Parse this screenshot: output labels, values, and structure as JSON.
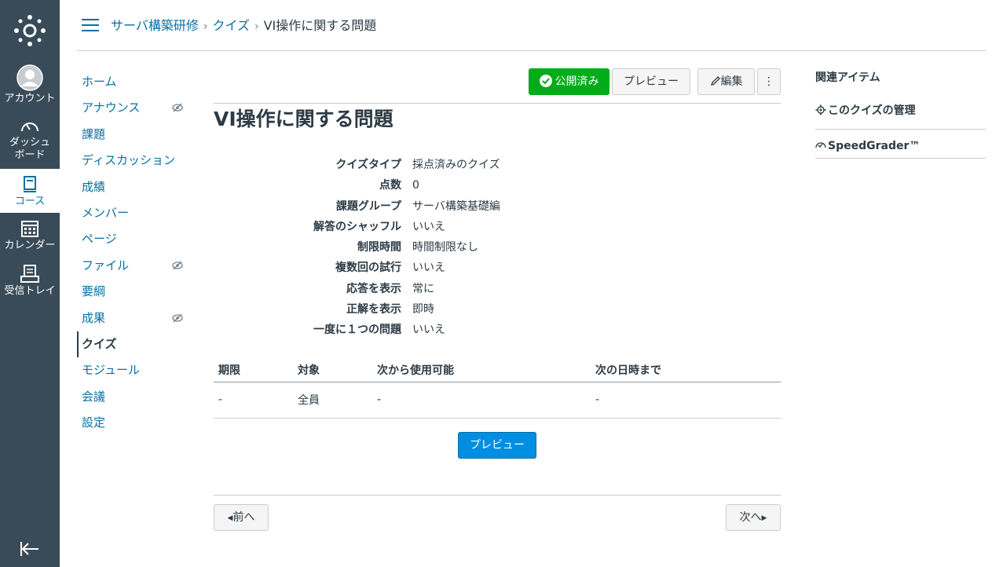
{
  "global_nav": {
    "items": [
      {
        "label": "アカウント",
        "icon": "avatar-icon"
      },
      {
        "label": "ダッシュ\nボード",
        "label1": "ダッシュ",
        "label2": "ボード",
        "icon": "dashboard-icon"
      },
      {
        "label": "コース",
        "icon": "courses-icon"
      },
      {
        "label": "カレンダー",
        "icon": "calendar-icon"
      },
      {
        "label": "受信トレイ",
        "icon": "inbox-icon"
      }
    ],
    "active_index": 2
  },
  "breadcrumb": {
    "items": [
      "サーバ構築研修",
      "クイズ",
      "VI操作に関する問題"
    ]
  },
  "course_nav": {
    "items": [
      {
        "label": "ホーム",
        "hidden": false
      },
      {
        "label": "アナウンス",
        "hidden": true
      },
      {
        "label": "課題",
        "hidden": false
      },
      {
        "label": "ディスカッション",
        "hidden": false
      },
      {
        "label": "成績",
        "hidden": false
      },
      {
        "label": "メンバー",
        "hidden": false
      },
      {
        "label": "ページ",
        "hidden": false
      },
      {
        "label": "ファイル",
        "hidden": true
      },
      {
        "label": "要綱",
        "hidden": false
      },
      {
        "label": "成果",
        "hidden": true
      },
      {
        "label": "クイズ",
        "hidden": false
      },
      {
        "label": "モジュール",
        "hidden": false
      },
      {
        "label": "会議",
        "hidden": false
      },
      {
        "label": "設定",
        "hidden": false
      }
    ],
    "active_index": 10
  },
  "toolbar": {
    "published_label": "公開済み",
    "preview_label": "プレビュー",
    "edit_label": "編集",
    "more_label": "⋮"
  },
  "quiz": {
    "title": "VI操作に関する問題",
    "details": [
      {
        "label": "クイズタイプ",
        "value": "採点済みのクイズ"
      },
      {
        "label": "点数",
        "value": "0"
      },
      {
        "label": "課題グループ",
        "value": "サーバ構築基礎編"
      },
      {
        "label": "解答のシャッフル",
        "value": "いいえ"
      },
      {
        "label": "制限時間",
        "value": "時間制限なし"
      },
      {
        "label": "複数回の試行",
        "value": "いいえ"
      },
      {
        "label": "応答を表示",
        "value": "常に"
      },
      {
        "label": "正解を表示",
        "value": "即時"
      },
      {
        "label": "一度に１つの問題",
        "value": "いいえ"
      }
    ],
    "table": {
      "headers": [
        "期限",
        "対象",
        "次から使用可能",
        "次の日時まで"
      ],
      "rows": [
        [
          "-",
          "全員",
          "-",
          "-"
        ]
      ]
    },
    "preview_button": "プレビュー",
    "prev_label": "前へ",
    "next_label": "次へ"
  },
  "sidebar": {
    "heading": "関連アイテム",
    "items": [
      "このクイズの管理",
      "SpeedGrader™"
    ]
  },
  "colors": {
    "nav_bg": "#394b58",
    "link": "#0770a3",
    "published": "#00ac18",
    "primary": "#008ee2"
  }
}
